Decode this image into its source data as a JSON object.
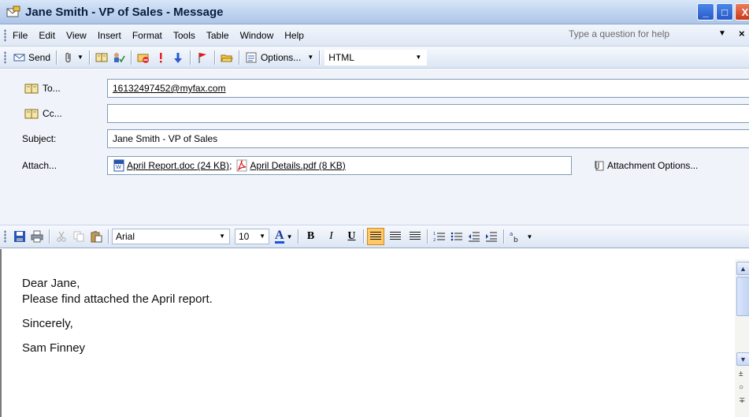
{
  "window": {
    "title": "Jane Smith - VP of Sales - Message",
    "minimize_glyph": "_",
    "maximize_glyph": "□",
    "close_glyph": "X"
  },
  "menubar": {
    "items": [
      "File",
      "Edit",
      "View",
      "Insert",
      "Format",
      "Tools",
      "Table",
      "Window",
      "Help"
    ],
    "help_placeholder": "Type a question for help",
    "help_dropdown_glyph": "▼",
    "close_glyph": "×"
  },
  "toolbar": {
    "send_label": "Send",
    "options_label": "Options...",
    "format_value": "HTML",
    "dropdown_glyph": "▼"
  },
  "headers": {
    "to_label": "To...",
    "to_value": "16132497452@myfax.com",
    "cc_label": "Cc...",
    "cc_value": "",
    "subject_label": "Subject:",
    "subject_value": "Jane Smith - VP of Sales",
    "attach_label": "Attach...",
    "attachments": [
      {
        "name": "April Report.doc (24 KB)",
        "icon": "word-doc-icon"
      },
      {
        "name": "April Details.pdf (8 KB)",
        "icon": "pdf-icon"
      }
    ],
    "attachment_separator": ";",
    "attachment_options_label": "Attachment Options..."
  },
  "formatting": {
    "font": "Arial",
    "size": "10",
    "bold": "B",
    "italic": "I",
    "underline": "U",
    "font_color_letter": "A",
    "dropdown_glyph": "▼"
  },
  "body": {
    "lines": [
      "Dear Jane,",
      "Please find attached the April report.",
      "",
      "Sincerely,",
      "",
      "Sam Finney"
    ]
  },
  "scrollbar": {
    "up_glyph": "▲",
    "down_glyph": "▼",
    "prev_glyph": "±",
    "browse_glyph": "○",
    "next_glyph": "∓"
  },
  "colors": {
    "titlebar": "#c2d6f0",
    "toolbar": "#dce6f4",
    "header_bg": "#f0f3f9",
    "active_button": "#ffc868"
  }
}
